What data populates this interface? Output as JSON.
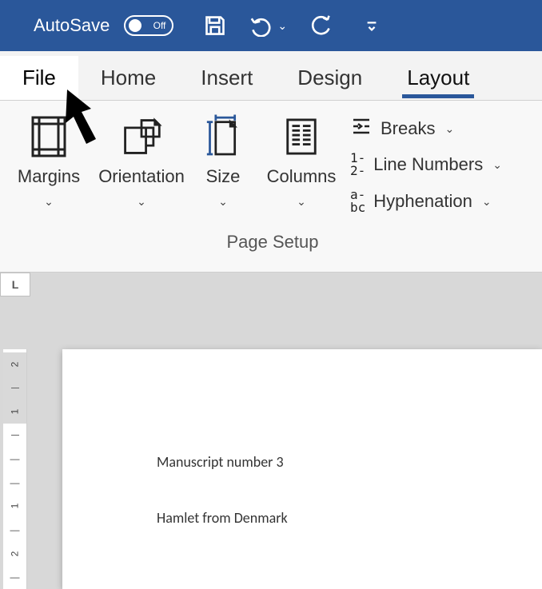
{
  "titlebar": {
    "autosave_label": "AutoSave",
    "autosave_state": "Off"
  },
  "tabs": {
    "file": "File",
    "home": "Home",
    "insert": "Insert",
    "design": "Design",
    "layout": "Layout"
  },
  "ribbon": {
    "margins": "Margins",
    "orientation": "Orientation",
    "size": "Size",
    "columns": "Columns",
    "breaks": "Breaks",
    "line_numbers": "Line Numbers",
    "hyphenation": "Hyphenation",
    "group_name": "Page Setup"
  },
  "ruler": {
    "corner": "L",
    "vmarks": [
      "2",
      "",
      "1",
      "",
      "—",
      "—",
      "1",
      "—",
      "2",
      "—",
      "—"
    ]
  },
  "document": {
    "line1": "Manuscript number 3",
    "line2": "Hamlet from Denmark"
  }
}
